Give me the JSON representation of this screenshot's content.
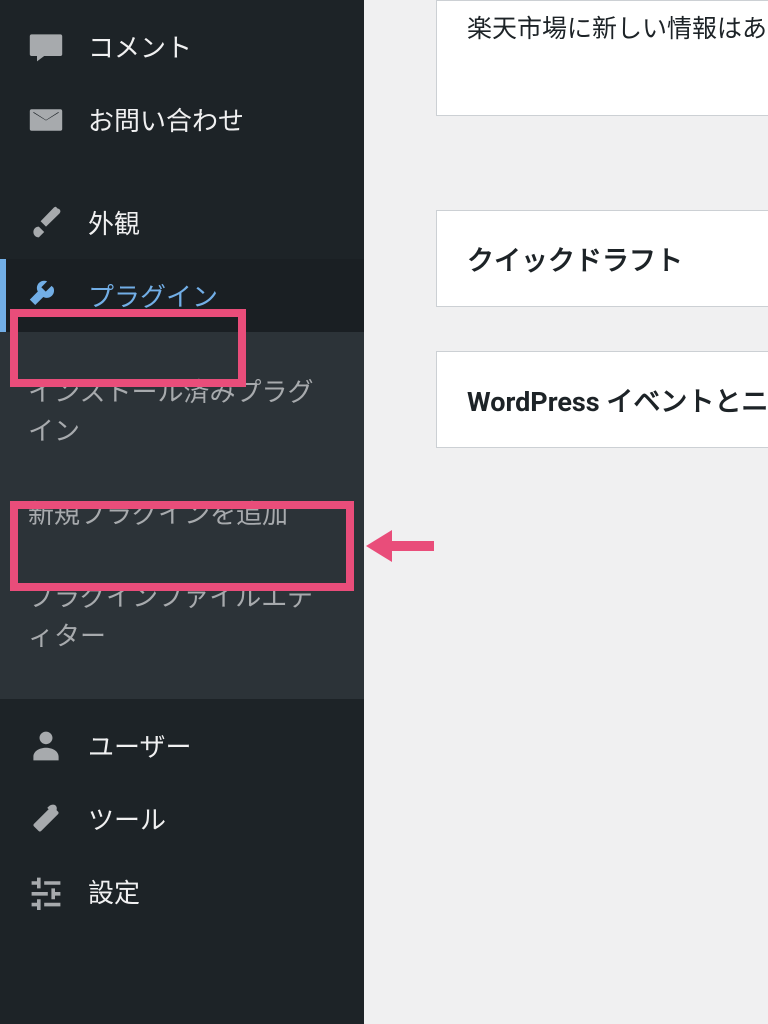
{
  "sidebar": {
    "items": [
      {
        "label": "コメント",
        "name": "sidebar-item-comments"
      },
      {
        "label": "お問い合わせ",
        "name": "sidebar-item-contact"
      },
      {
        "label": "外観",
        "name": "sidebar-item-appearance"
      },
      {
        "label": "プラグイン",
        "name": "sidebar-item-plugins"
      },
      {
        "label": "ユーザー",
        "name": "sidebar-item-users"
      },
      {
        "label": "ツール",
        "name": "sidebar-item-tools"
      },
      {
        "label": "設定",
        "name": "sidebar-item-settings"
      }
    ],
    "submenu": [
      {
        "label": "インストール済みプラグイン",
        "name": "submenu-installed-plugins"
      },
      {
        "label": "新規プラグインを追加",
        "name": "submenu-add-new-plugin"
      },
      {
        "label": "プラグインファイルエディター",
        "name": "submenu-plugin-editor"
      }
    ]
  },
  "content": {
    "panel1": "楽天市場に新しい情報はあり",
    "panel2": "クイックドラフト",
    "panel3": "WordPress イベントとニ"
  },
  "annotation": {
    "highlight_color": "#e94d7a"
  }
}
